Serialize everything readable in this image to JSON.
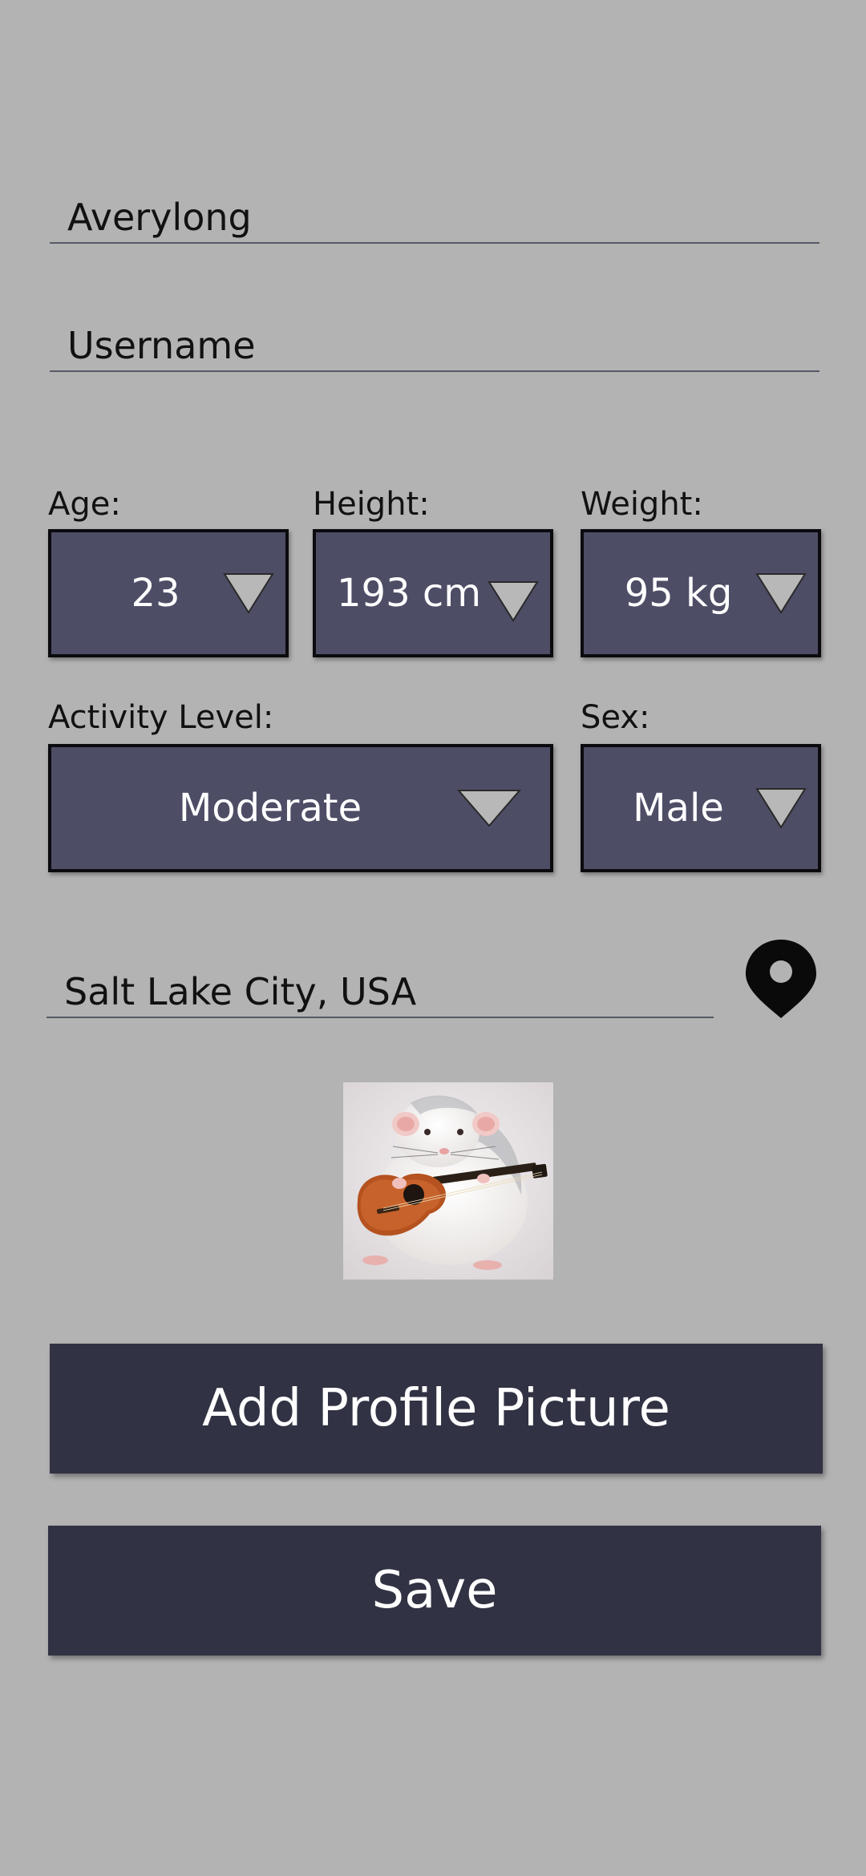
{
  "form": {
    "name_value": "Averylong",
    "username_placeholder": "Username",
    "age_label": "Age:",
    "age_value": "23",
    "height_label": "Height:",
    "height_value": "193 cm",
    "weight_label": "Weight:",
    "weight_value": "95 kg",
    "activity_label": "Activity Level:",
    "activity_value": "Moderate",
    "sex_label": "Sex:",
    "sex_value": "Male",
    "location_value": "Salt Lake City, USA"
  },
  "buttons": {
    "add_picture_label": "Add Profile Picture",
    "save_label": "Save"
  },
  "icons": {
    "dropdown": "triangle-down-icon",
    "location": "map-pin-icon"
  },
  "colors": {
    "background": "#b3b3b3",
    "select_fill": "#4d4d66",
    "button_fill": "#313243",
    "arrow_fill": "#b8b8b8"
  }
}
